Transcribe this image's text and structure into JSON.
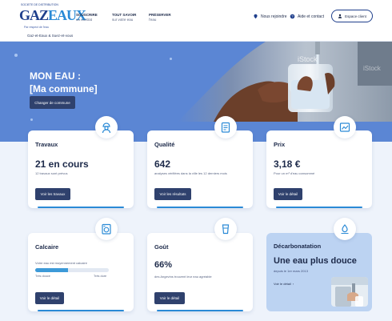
{
  "header": {
    "logo_top": "SOCIETE DE DISTRIBUTION",
    "logo_word_a": "GAZ",
    "logo_word_b": "EAUX",
    "logo_sub": "Par respect de l'eau",
    "tagline": "Gaz-et-Eaux & Suez-et-vous",
    "nav": [
      {
        "label": "SOUSCRIRE",
        "sub": "un contrat"
      },
      {
        "label": "TOUT SAVOIR",
        "sub": "sur votre eau"
      },
      {
        "label": "PRÉSERVER",
        "sub": "l'eau"
      }
    ],
    "util": [
      {
        "label": "Nous rejoindre",
        "icon": "pin-icon"
      },
      {
        "label": "Aide et contact",
        "icon": "help-icon"
      }
    ],
    "account_label": "Espace client"
  },
  "hero": {
    "title_line1": "MON EAU :",
    "title_line2": "[Ma commune]",
    "button_label": "Changer de commune",
    "watermark": "iStock",
    "colors": {
      "background": "#5b86d4"
    }
  },
  "cards": {
    "travaux": {
      "title": "Travaux",
      "value": "21 en cours",
      "desc": "12 travaux sont prévus",
      "button": "Voir les travaux",
      "icon": "worker-icon"
    },
    "qualite": {
      "title": "Qualité",
      "value": "642",
      "desc": "analyses vérifiées dans la ville les 12 derniers mois",
      "button": "Voir les résultats",
      "icon": "clipboard-icon"
    },
    "prix": {
      "title": "Prix",
      "value": "3,18 €",
      "desc": "Pour un m³ d'eau consommé",
      "button": "Voir le détail",
      "icon": "chart-icon"
    },
    "calcaire": {
      "title": "Calcaire",
      "desc": "Votre eau est moyennement calcaire",
      "level_fraction": 0.45,
      "scale_min": "Très douce",
      "scale_max": "Très dure",
      "button": "Voir le détail",
      "icon": "washing-machine-icon"
    },
    "gout": {
      "title": "Goût",
      "value": "66%",
      "desc": "des Angevins trouvent leur eau agréable",
      "button": "Voir le détail",
      "icon": "glass-icon"
    },
    "decarbonatation": {
      "title": "Décarbonatation",
      "big": "Une eau plus douce",
      "desc": "depuis le 1er mars 2013",
      "link": "Voir le détail",
      "icon": "water-drops-icon"
    }
  },
  "colors": {
    "accent": "#2a8ad6",
    "dark_button": "#2f416d",
    "text": "#1d2a4a"
  }
}
